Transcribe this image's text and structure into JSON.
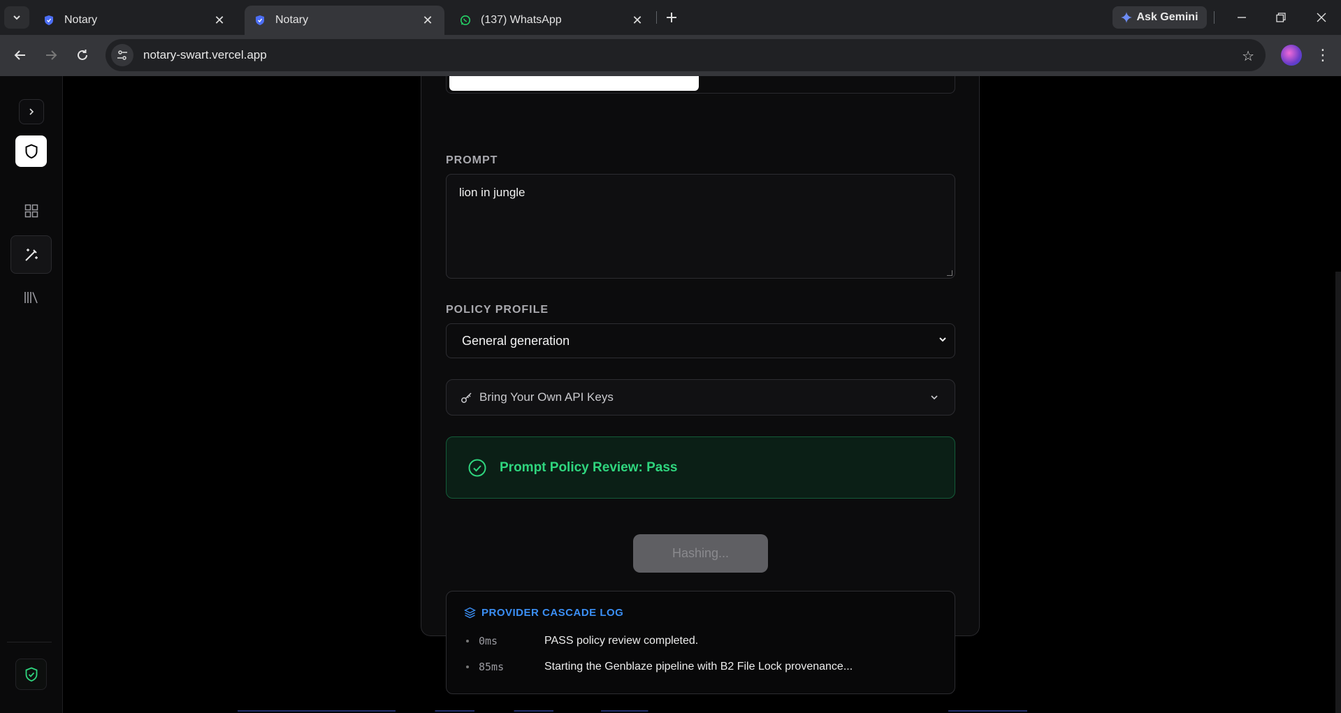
{
  "browser": {
    "tabs": [
      {
        "title": "Notary",
        "icon": "notary-shield-icon",
        "active": false
      },
      {
        "title": "Notary",
        "icon": "notary-shield-icon",
        "active": true
      },
      {
        "title": "(137) WhatsApp",
        "icon": "whatsapp-icon",
        "active": false
      }
    ],
    "gemini_label": "Ask Gemini",
    "url": "notary-swart.vercel.app"
  },
  "sidebar": {
    "items": [
      {
        "name": "expand",
        "icon": "chevron-right-icon"
      },
      {
        "name": "logo",
        "icon": "shield-icon"
      },
      {
        "name": "dashboard",
        "icon": "grid-icon"
      },
      {
        "name": "generate",
        "icon": "magic-wand-icon",
        "active": true
      },
      {
        "name": "library",
        "icon": "library-icon"
      },
      {
        "name": "verify",
        "icon": "shield-check-icon"
      }
    ]
  },
  "form": {
    "prompt_label": "PROMPT",
    "prompt_value": "lion in jungle",
    "policy_label": "POLICY PROFILE",
    "policy_selected": "General generation",
    "byok_label": "Bring Your Own API Keys",
    "review_text": "Prompt Policy Review: Pass",
    "hash_button": "Hashing..."
  },
  "log": {
    "title": "PROVIDER CASCADE LOG",
    "entries": [
      {
        "time": "0ms",
        "message": "PASS policy review completed."
      },
      {
        "time": "85ms",
        "message": "Starting the Genblaze pipeline with B2 File Lock provenance..."
      }
    ]
  },
  "colors": {
    "accent_green": "#2fd57e",
    "accent_blue": "#3b8ff5",
    "background": "#000000"
  }
}
